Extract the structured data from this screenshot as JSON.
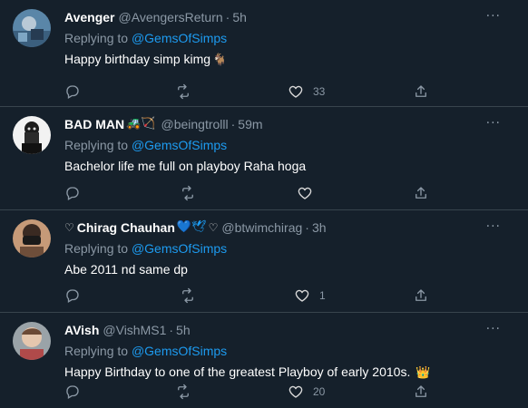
{
  "tweets": [
    {
      "name": "Avenger",
      "handle": "@AvengersReturn",
      "time": "5h",
      "replying_prefix": "Replying to",
      "replying_to": "@GemsOfSimps",
      "text": "Happy birthday simp kimg",
      "text_emoji": "🐐",
      "likes": "33"
    },
    {
      "name": "BAD MAN",
      "name_emoji": "🚜🏹",
      "handle": "@beingtrolll",
      "time": "59m",
      "replying_prefix": "Replying to",
      "replying_to": "@GemsOfSimps",
      "text": "Bachelor life me full on playboy Raha hoga",
      "likes": ""
    },
    {
      "name_prefix": "♡",
      "name": "Chirag Chauhan",
      "name_emoji": "💙🕊",
      "name_suffix": "♡",
      "handle": "@btwimchirag",
      "time": "3h",
      "replying_prefix": "Replying to",
      "replying_to": "@GemsOfSimps",
      "text": "Abe 2011 nd same dp",
      "likes": "1"
    },
    {
      "name": "AVish",
      "handle": "@VishMS1",
      "time": "5h",
      "replying_prefix": "Replying to",
      "replying_to": "@GemsOfSimps",
      "text": "Happy Birthday to one of the greatest Playboy of early 2010s.",
      "text_emoji": "👑",
      "likes": "20"
    }
  ],
  "common": {
    "dot": "·",
    "more": "···"
  },
  "colors": {
    "background": "#15202b",
    "accent": "#1d9bf0",
    "muted": "#8b98a5",
    "divider": "#38444d"
  },
  "icons": [
    "reply-icon",
    "retweet-icon",
    "like-icon",
    "share-icon",
    "more-icon"
  ]
}
